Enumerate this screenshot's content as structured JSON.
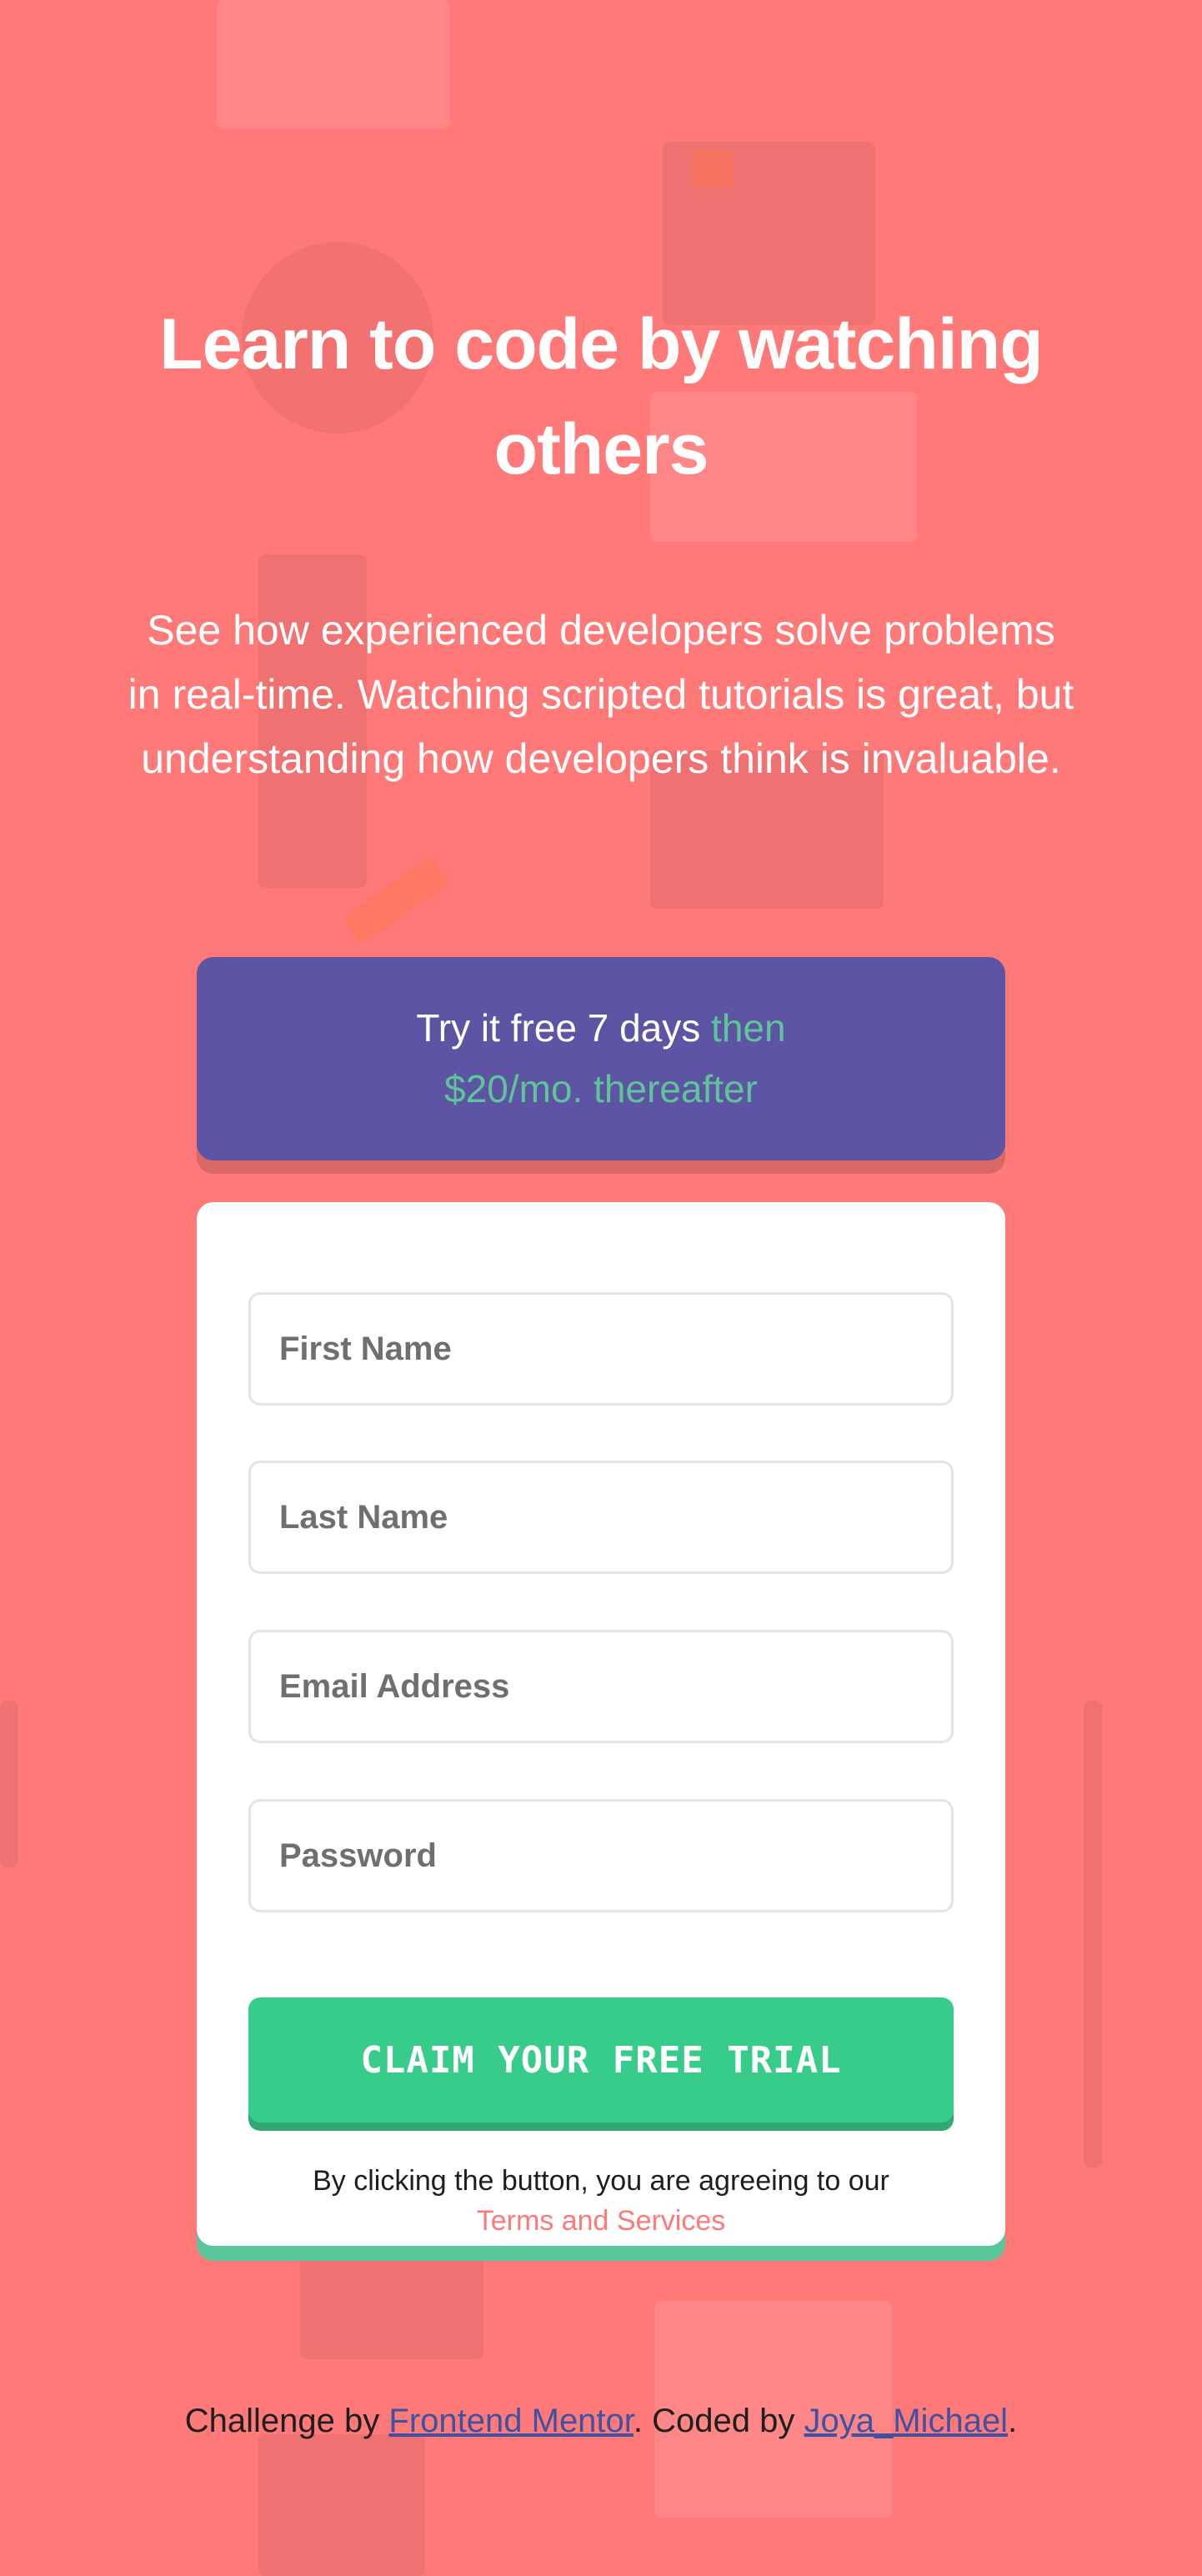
{
  "hero": {
    "title": "Learn to code by watching others",
    "description": "See how experienced developers solve problems in real-time. Watching scripted tutorials is great, but understanding how developers think is invaluable."
  },
  "offer": {
    "strong_text": "Try it free 7 days",
    "light_text": "then $20/mo. thereafter"
  },
  "form": {
    "fields": [
      {
        "placeholder": "First Name",
        "value": ""
      },
      {
        "placeholder": "Last Name",
        "value": ""
      },
      {
        "placeholder": "Email Address",
        "value": ""
      },
      {
        "placeholder": "Password",
        "value": ""
      }
    ],
    "submit_label": "CLAIM YOUR FREE TRIAL",
    "terms_prefix": "By clicking the button, you are agreeing to our",
    "terms_link": "Terms and Services"
  },
  "footer": {
    "challenge_prefix": "Challenge by",
    "challenge_link": "Frontend Mentor",
    "coded_prefix": ". Coded by",
    "coded_link": "Joya_Michael",
    "suffix": "."
  },
  "colors": {
    "background": "#ff7979",
    "banner": "#5e54a4",
    "accent_green": "#38cc8b",
    "banner_light_text": "#5fc49a"
  },
  "icons": [
    "house-icon",
    "toolbox-icon",
    "network-icon",
    "calendar-icon"
  ]
}
